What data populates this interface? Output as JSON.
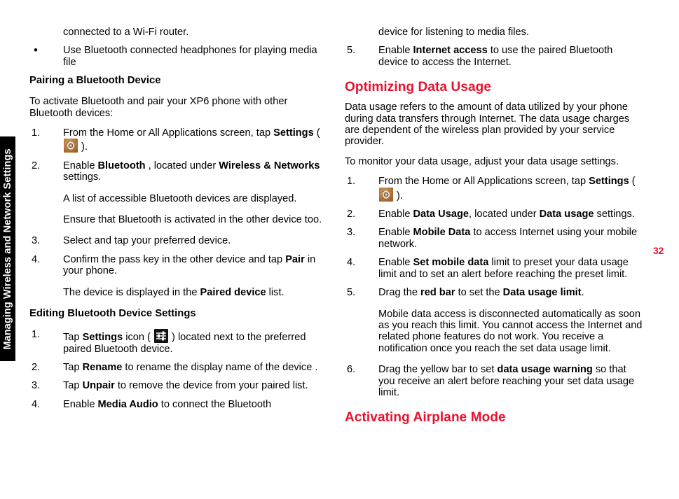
{
  "chapter_tab": {
    "label": "Managing Wireless and Network Settings"
  },
  "page_number": "32",
  "colors": {
    "heading_red": "#E8112D",
    "tab_background": "#000000",
    "text": "#000000"
  },
  "icons": {
    "gear": "settings-gear-icon",
    "sliders": "settings-sliders-icon"
  },
  "left_column": {
    "continued_line": "connected to a Wi-Fi router.",
    "bullet_item": {
      "marker": "•",
      "text": "Use Bluetooth connected headphones for playing media file"
    },
    "heading_pairing": "Pairing a Bluetooth Device",
    "intro": "To activate Bluetooth and pair your XP6 phone with other Bluetooth devices:",
    "steps": [
      {
        "marker": "1.",
        "parts": [
          {
            "type": "text",
            "value": "From the Home or All Applications screen, tap "
          },
          {
            "type": "bold",
            "value": "Settings"
          },
          {
            "type": "text",
            "value": " ( "
          },
          {
            "type": "icon",
            "value": "gear"
          },
          {
            "type": "text",
            "value": " )."
          }
        ]
      },
      {
        "marker": "2.",
        "parts": [
          {
            "type": "text",
            "value": "Enable "
          },
          {
            "type": "bold",
            "value": "Bluetooth"
          },
          {
            "type": "text",
            "value": " , located under "
          },
          {
            "type": "bold",
            "value": "Wireless & Networks"
          },
          {
            "type": "text",
            "value": " settings."
          }
        ]
      },
      {
        "marker": "",
        "continuation": true,
        "parts": [
          {
            "type": "text",
            "value": "A list of accessible Bluetooth devices are displayed."
          }
        ]
      },
      {
        "marker": "",
        "continuation": true,
        "parts": [
          {
            "type": "text",
            "value": "Ensure that Bluetooth is activated in the other device too."
          }
        ]
      },
      {
        "marker": "3.",
        "parts": [
          {
            "type": "text",
            "value": "Select and tap your preferred device."
          }
        ]
      },
      {
        "marker": "4.",
        "parts": [
          {
            "type": "text",
            "value": "Confirm the pass key in the other device and tap "
          },
          {
            "type": "bold",
            "value": "Pair"
          },
          {
            "type": "text",
            "value": " in your phone."
          }
        ]
      },
      {
        "marker": "",
        "continuation": true,
        "parts": [
          {
            "type": "text",
            "value": "The device is displayed in the "
          },
          {
            "type": "bold",
            "value": "Paired device"
          },
          {
            "type": "text",
            "value": " list."
          }
        ]
      }
    ],
    "heading_editing": "Editing Bluetooth Device Settings",
    "edit_steps": [
      {
        "marker": "1.",
        "parts": [
          {
            "type": "text",
            "value": "Tap "
          },
          {
            "type": "bold",
            "value": "Settings"
          },
          {
            "type": "text",
            "value": " icon ( "
          },
          {
            "type": "icon",
            "value": "sliders"
          },
          {
            "type": "text",
            "value": " ) located next to the preferred paired Bluetooth device."
          }
        ]
      },
      {
        "marker": "2.",
        "parts": [
          {
            "type": "text",
            "value": "Tap "
          },
          {
            "type": "bold",
            "value": "Rename"
          },
          {
            "type": "text",
            "value": " to rename the display name of the device ."
          }
        ]
      },
      {
        "marker": "3.",
        "parts": [
          {
            "type": "text",
            "value": "Tap "
          },
          {
            "type": "bold",
            "value": "Unpair"
          },
          {
            "type": "text",
            "value": " to remove the device from your paired list."
          }
        ]
      },
      {
        "marker": "4.",
        "parts": [
          {
            "type": "text",
            "value": "Enable "
          },
          {
            "type": "bold",
            "value": "Media Audio"
          },
          {
            "type": "text",
            "value": " to connect the Bluetooth"
          }
        ]
      }
    ]
  },
  "right_column": {
    "continued_line": "device for listening to media files.",
    "step5": {
      "marker": "5.",
      "parts": [
        {
          "type": "text",
          "value": "Enable "
        },
        {
          "type": "bold",
          "value": "Internet access"
        },
        {
          "type": "text",
          "value": " to use the paired Bluetooth device to access the Internet."
        }
      ]
    },
    "heading_optimizing": "Optimizing Data Usage",
    "para1": "Data usage refers to the amount of data utilized by your phone during data transfers through Internet. The data usage charges are dependent of the wireless plan provided by your service provider.",
    "para2": "To monitor your data usage, adjust your data usage settings.",
    "steps": [
      {
        "marker": "1.",
        "parts": [
          {
            "type": "text",
            "value": "From the Home or All Applications screen, tap "
          },
          {
            "type": "bold",
            "value": "Settings"
          },
          {
            "type": "text",
            "value": " ( "
          },
          {
            "type": "icon",
            "value": "gear"
          },
          {
            "type": "text",
            "value": " )."
          }
        ]
      },
      {
        "marker": "2.",
        "parts": [
          {
            "type": "text",
            "value": "Enable "
          },
          {
            "type": "bold",
            "value": "Data Usage"
          },
          {
            "type": "text",
            "value": ", located under "
          },
          {
            "type": "bold",
            "value": "Data usage"
          },
          {
            "type": "text",
            "value": " settings."
          }
        ]
      },
      {
        "marker": "3.",
        "parts": [
          {
            "type": "text",
            "value": "Enable "
          },
          {
            "type": "bold",
            "value": "Mobile Data"
          },
          {
            "type": "text",
            "value": " to access Internet using your mobile network."
          }
        ]
      },
      {
        "marker": "4.",
        "parts": [
          {
            "type": "text",
            "value": "Enable "
          },
          {
            "type": "bold",
            "value": "Set mobile data"
          },
          {
            "type": "text",
            "value": " limit to preset your data usage limit and to set an alert before reaching the preset limit."
          }
        ]
      },
      {
        "marker": "5.",
        "parts": [
          {
            "type": "text",
            "value": "Drag the "
          },
          {
            "type": "bold",
            "value": "red bar"
          },
          {
            "type": "text",
            "value": " to set the "
          },
          {
            "type": "bold",
            "value": "Data usage limit"
          },
          {
            "type": "text",
            "value": "."
          }
        ]
      },
      {
        "marker": "",
        "continuation": true,
        "parts": [
          {
            "type": "text",
            "value": "Mobile data access is disconnected automatically as soon as you reach this limit. You cannot access the Internet and related phone features do not work. You receive a notification once you reach the set data usage limit."
          }
        ]
      },
      {
        "marker": "6.",
        "parts": [
          {
            "type": "text",
            "value": "Drag the yellow bar to set "
          },
          {
            "type": "bold",
            "value": "data usage warning"
          },
          {
            "type": "text",
            "value": " so that you receive an alert before reaching your set data usage limit."
          }
        ]
      }
    ],
    "heading_airplane": "Activating Airplane Mode"
  }
}
